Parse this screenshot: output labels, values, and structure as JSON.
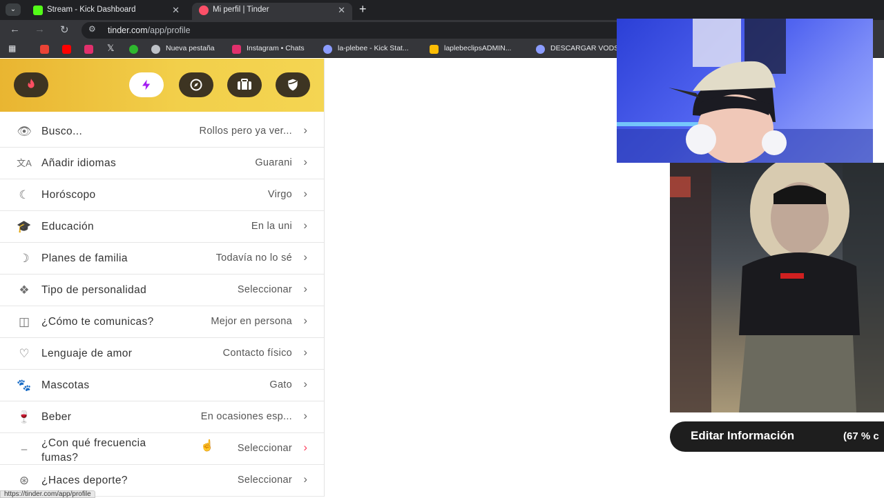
{
  "tabs": [
    {
      "title": "Stream - Kick Dashboard",
      "favicon_color": "#53fc18"
    },
    {
      "title": "Mi perfil | Tinder",
      "favicon_color": "#fd5068"
    }
  ],
  "address": {
    "domain": "tinder.com",
    "path": "/app/profile"
  },
  "bookmarks": [
    {
      "label": "Nueva pestaña",
      "icon_color": "#bdc1c6"
    },
    {
      "label": "Instagram • Chats",
      "icon_color": "#e1306c"
    },
    {
      "label": "la-plebee - Kick Stat...",
      "icon_color": "#8b9cff"
    },
    {
      "label": "laplebeclipsADMIN...",
      "icon_color": "#fbbc04"
    },
    {
      "label": "DESCARGAR VODS",
      "icon_color": "#8b9cff"
    }
  ],
  "header_nav": [
    "tinder-flame-icon",
    "boost-bolt-icon",
    "explore-compass-icon",
    "toolbox-icon",
    "safety-shield-icon"
  ],
  "profile_rows": [
    {
      "icon": "eye-icon",
      "label": "Busco...",
      "value": "Rollos pero ya ver..."
    },
    {
      "icon": "language-icon",
      "label": "Añadir idiomas",
      "value": "Guarani"
    },
    {
      "icon": "moon-icon",
      "label": "Horóscopo",
      "value": "Virgo"
    },
    {
      "icon": "graduation-cap-icon",
      "label": "Educación",
      "value": "En la uni"
    },
    {
      "icon": "cradle-icon",
      "label": "Planes de familia",
      "value": "Todavía no lo sé"
    },
    {
      "icon": "puzzle-icon",
      "label": "Tipo de personalidad",
      "value": "Seleccionar"
    },
    {
      "icon": "chat-icon",
      "label": "¿Cómo te comunicas?",
      "value": "Mejor en persona"
    },
    {
      "icon": "heart-chat-icon",
      "label": "Lenguaje de amor",
      "value": "Contacto físico"
    },
    {
      "icon": "paw-icon",
      "label": "Mascotas",
      "value": "Gato"
    },
    {
      "icon": "glass-icon",
      "label": "Beber",
      "value": "En ocasiones esp..."
    },
    {
      "icon": "cigarette-icon",
      "label": "¿Con qué frecuencia fumas?",
      "value": "Seleccionar"
    },
    {
      "icon": "dumbbell-icon",
      "label": "¿Haces deporte?",
      "value": "Seleccionar"
    }
  ],
  "status_bar_url": "https://tinder.com/app/profile",
  "edit_button": {
    "label": "Editar Información",
    "percent": "(67 % c"
  },
  "colors": {
    "header_gold": "#f2cf4a",
    "accent_red": "#fd3e5c"
  }
}
